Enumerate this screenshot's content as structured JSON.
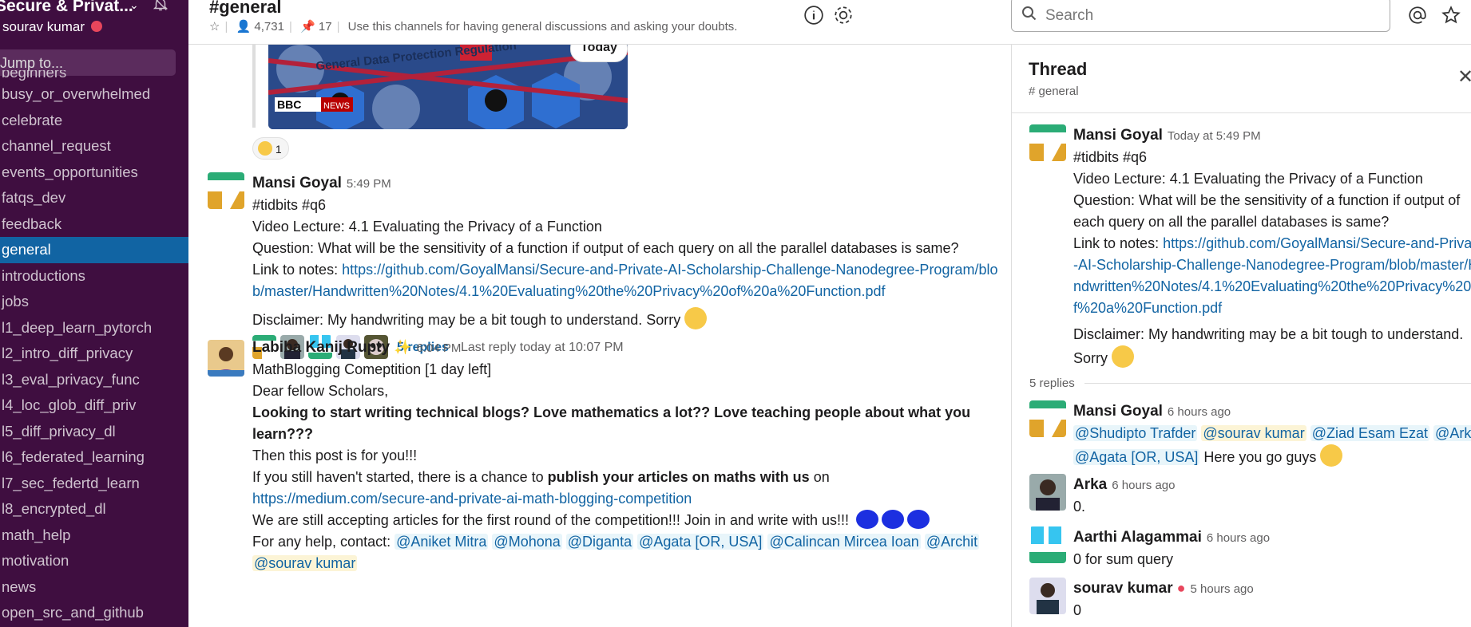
{
  "workspace": {
    "name": "Secure & Privat...",
    "user": "sourav kumar"
  },
  "sidebar": {
    "jump_label": "Jump to...",
    "channels": [
      "beginners",
      "busy_or_overwhelmed",
      "celebrate",
      "channel_request",
      "events_opportunities",
      "fatqs_dev",
      "feedback",
      "general",
      "introductions",
      "jobs",
      "l1_deep_learn_pytorch",
      "l2_intro_diff_privacy",
      "l3_eval_privacy_func",
      "l4_loc_glob_diff_priv",
      "l5_diff_privacy_dl",
      "l6_federated_learning",
      "l7_sec_federtd_learn",
      "l8_encrypted_dl",
      "math_help",
      "motivation",
      "news",
      "open_src_and_github"
    ],
    "active": "general"
  },
  "header": {
    "title": "#general",
    "members": "4,731",
    "pins": "17",
    "topic": "Use this channels for having general discussions and asking your doubts.",
    "search_placeholder": "Search"
  },
  "messages": {
    "date_divider": "Today",
    "preview": {
      "title": "General Data Protection Regulation",
      "badge_bbc": "BBC",
      "badge_news": "NEWS"
    },
    "reaction_count": "1",
    "m1": {
      "author": "Mansi Goyal",
      "time": "5:49 PM",
      "l1": "#tidbits #q6",
      "l2": "Video Lecture: 4.1 Evaluating the Privacy of a Function",
      "l3": "Question: What will be the sensitivity of a function if output of each query on all the parallel databases is same?",
      "l4_prefix": "Link to notes: ",
      "link": "https://github.com/GoyalMansi/Secure-and-Private-AI-Scholarship-Challenge-Nanodegree-Program/blob/master/Handwritten%20Notes/4.1%20Evaluating%20the%20Privacy%20of%20a%20Function.pdf",
      "disclaimer": "Disclaimer: My handwriting may be a bit tough to understand. Sorry",
      "replies": "5 replies",
      "last_reply": "Last reply today at 10:07 PM"
    },
    "m2": {
      "author": "Labiba Kanij Rupty",
      "time": "6:04 PM",
      "l1": "MathBlogging Comeptition [1 day left]",
      "l2": "Dear fellow Scholars,",
      "l3": "Looking to start writing technical blogs?  Love mathematics a lot?? Love teaching people about what you learn???",
      "l4": "Then this post is for you!!!",
      "l5a": "If you still haven't started, there is a chance to ",
      "l5b": "publish your articles on maths with us",
      "l5c": " on",
      "link": "https://medium.com/secure-and-private-ai-math-blogging-competition",
      "l6": "We are still accepting articles for the first round of the competition!!! Join in and write with us!!!",
      "l7": "For any help, contact: ",
      "mentions": [
        "@Aniket Mitra",
        "@Mohona",
        "@Diganta",
        "@Agata [OR, USA]",
        "@Calincan Mircea Ioan",
        "@Archit",
        "@sourav kumar"
      ]
    }
  },
  "thread": {
    "title": "Thread",
    "channel": "# general",
    "parent": {
      "author": "Mansi Goyal",
      "time": "Today at 5:49 PM",
      "l1": "#tidbits #q6",
      "l2": "Video Lecture: 4.1 Evaluating the Privacy of a Function",
      "l3": "Question: What will be the sensitivity of a function if output of each query on all the parallel databases is same?",
      "l4_prefix": "Link to notes: ",
      "link": "https://github.com/GoyalMansi/Secure-and-Private-AI-Scholarship-Challenge-Nanodegree-Program/blob/master/Handwritten%20Notes/4.1%20Evaluating%20the%20Privacy%20of%20a%20Function.pdf",
      "disclaimer": "Disclaimer: My handwriting may be a bit tough to understand. Sorry"
    },
    "reply_count": "5 replies",
    "replies": [
      {
        "author": "Mansi Goyal",
        "time": "6 hours ago",
        "mentions": [
          "@Shudipto Trafder",
          "@sourav kumar",
          "@Ziad Esam Ezat",
          "@Arka",
          "@Agata [OR, USA]"
        ],
        "text": " Here you go guys"
      },
      {
        "author": "Arka",
        "time": "6 hours ago",
        "text": "0."
      },
      {
        "author": "Aarthi Alagammai",
        "time": "6 hours ago",
        "text": "0 for sum query"
      },
      {
        "author": "sourav kumar",
        "time": "5 hours ago",
        "text": "0"
      }
    ]
  },
  "colors": {
    "sidebar": "#3f0e40",
    "active": "#1164a3",
    "link": "#1264a3"
  }
}
